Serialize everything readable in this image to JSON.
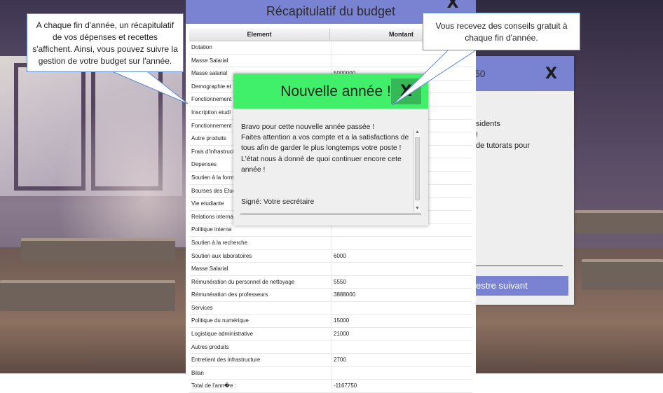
{
  "budget_summary": {
    "title": "Récapitulatif du budget",
    "close_label": "X",
    "columns": [
      "Element",
      "Montant"
    ],
    "rows": [
      {
        "element": "Dotation",
        "amount": ""
      },
      {
        "element": "Masse Salarial",
        "amount": ""
      },
      {
        "element": "Masse salarial",
        "amount": "5000000"
      },
      {
        "element": "Demographie et",
        "amount": ""
      },
      {
        "element": "Fonctionnement",
        "amount": ""
      },
      {
        "element": "Inscription etudi",
        "amount": ""
      },
      {
        "element": "Fonctionnement",
        "amount": ""
      },
      {
        "element": "Autre produits",
        "amount": ""
      },
      {
        "element": "Frais d'infrastruct",
        "amount": ""
      },
      {
        "element": "Depenses",
        "amount": ""
      },
      {
        "element": "Soutien à la form",
        "amount": ""
      },
      {
        "element": "Bourses des Etud",
        "amount": ""
      },
      {
        "element": "Vie etudiante",
        "amount": ""
      },
      {
        "element": "Relations interna",
        "amount": ""
      },
      {
        "element": "Politique interna",
        "amount": ""
      },
      {
        "element": "Soutien à la recherche",
        "amount": ""
      },
      {
        "element": "Soutien aux laboratoires",
        "amount": "6000"
      },
      {
        "element": "Masse Salarial",
        "amount": ""
      },
      {
        "element": "Rémunération du personnel de nettoyage",
        "amount": "5550"
      },
      {
        "element": "Rémunération des professeurs",
        "amount": "3888000"
      },
      {
        "element": "Services",
        "amount": ""
      },
      {
        "element": "Politique du numérique",
        "amount": "15000"
      },
      {
        "element": "Logistique administrative",
        "amount": "21000"
      },
      {
        "element": "Autres produits",
        "amount": ""
      },
      {
        "element": "Entretient des infrastructure",
        "amount": "2700"
      },
      {
        "element": "Bilan",
        "amount": ""
      },
      {
        "element": "Total de l'ann�e :",
        "amount": "-1167750"
      }
    ]
  },
  "new_year_popup": {
    "title": "Nouvelle année !",
    "close_label": "X",
    "message_lines": [
      "Bravo pour cette nouvelle année passée !",
      "Faites attention a vos compte et a la satisfactions de tous afin de garder le plus longtemps votre poste !",
      "L'état nous à donné de quoi continuer encore cete année !"
    ],
    "signature": "Signé: Votre secrétaire"
  },
  "background_dialog": {
    "title_fragment": "50",
    "close_label": "X",
    "text_fragments": [
      "sidents",
      "!",
      "de tutorats pour"
    ],
    "next_button": "estre suivant"
  },
  "callouts": {
    "left": "A chaque fin d'année, un récapitulatif de vos dépenses et recettes s'affichent. Ainsi, vous pouvez suivre la gestion de votre budget sur l'année.",
    "right": "Vous recevez des conseils gratuit à chaque fin d'année."
  },
  "colors": {
    "header_blue": "#7a82d2",
    "popup_green": "#41f06a",
    "popup_close_green": "#35b957",
    "callout_border": "#5b8ad0"
  }
}
